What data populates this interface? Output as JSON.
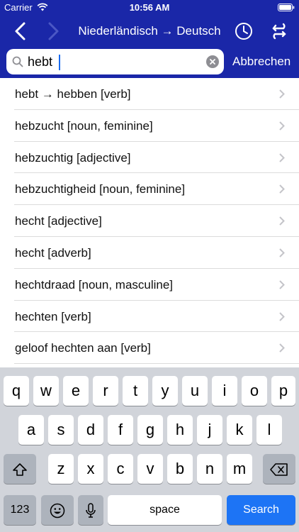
{
  "status_bar": {
    "carrier": "Carrier",
    "time": "10:56 AM"
  },
  "nav": {
    "title": "Niederländisch → Deutsch"
  },
  "search": {
    "value": "hebt",
    "cancel_label": "Abbrechen"
  },
  "results": [
    "hebt → hebben [verb]",
    "hebzucht [noun, feminine]",
    "hebzuchtig [adjective]",
    "hebzuchtigheid [noun, feminine]",
    "hecht [adjective]",
    "hecht [adverb]",
    "hechtdraad [noun, masculine]",
    "hechten [verb]",
    "geloof hechten aan [verb]"
  ],
  "keyboard": {
    "row1": [
      "q",
      "w",
      "e",
      "r",
      "t",
      "y",
      "u",
      "i",
      "o",
      "p"
    ],
    "row2": [
      "a",
      "s",
      "d",
      "f",
      "g",
      "h",
      "j",
      "k",
      "l"
    ],
    "row3": [
      "z",
      "x",
      "c",
      "v",
      "b",
      "n",
      "m"
    ],
    "numbers_label": "123",
    "space_label": "space",
    "search_label": "Search"
  },
  "colors": {
    "header_bg": "#1a27a8",
    "search_key": "#1d74f5"
  }
}
